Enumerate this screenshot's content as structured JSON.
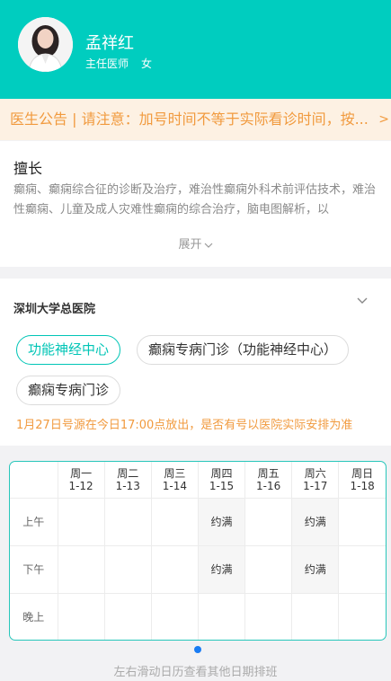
{
  "doctor": {
    "name": "孟祥红",
    "title": "主任医师",
    "gender": "女"
  },
  "notice": {
    "text": "医生公告 | 请注意：加号时间不等于实际看诊时间，按..."
  },
  "specialty": {
    "title": "擅长",
    "text": "癫痫、癫痫综合征的诊断及治疗，难治性癫痫外科术前评估技术，难治性癫痫、儿童及成人灾难性癫痫的综合治疗，脑电图解析，以",
    "expand_label": "展开"
  },
  "hospital": {
    "name": "深圳大学总医院",
    "departments": [
      "功能神经中心",
      "癫痫专病门诊（功能神经中心）",
      "癫痫专病门诊"
    ],
    "selected": "功能神经中心",
    "release_notice": "1月27日号源在今日17:00点放出，是否有号以医院实际安排为准"
  },
  "schedule": {
    "days": [
      {
        "weekday": "周一",
        "date": "1-12"
      },
      {
        "weekday": "周二",
        "date": "1-13"
      },
      {
        "weekday": "周三",
        "date": "1-14"
      },
      {
        "weekday": "周四",
        "date": "1-15"
      },
      {
        "weekday": "周五",
        "date": "1-16"
      },
      {
        "weekday": "周六",
        "date": "1-17"
      },
      {
        "weekday": "周日",
        "date": "1-18"
      }
    ],
    "periods": [
      {
        "label": "上午",
        "slots": [
          "",
          "",
          "",
          "约满",
          "",
          "约满",
          ""
        ]
      },
      {
        "label": "下午",
        "slots": [
          "",
          "",
          "",
          "约满",
          "",
          "约满",
          ""
        ]
      },
      {
        "label": "晚上",
        "slots": [
          "",
          "",
          "",
          "",
          "",
          "",
          ""
        ]
      }
    ]
  },
  "scroll_hint": "左右滑动日历查看其他日期排班"
}
